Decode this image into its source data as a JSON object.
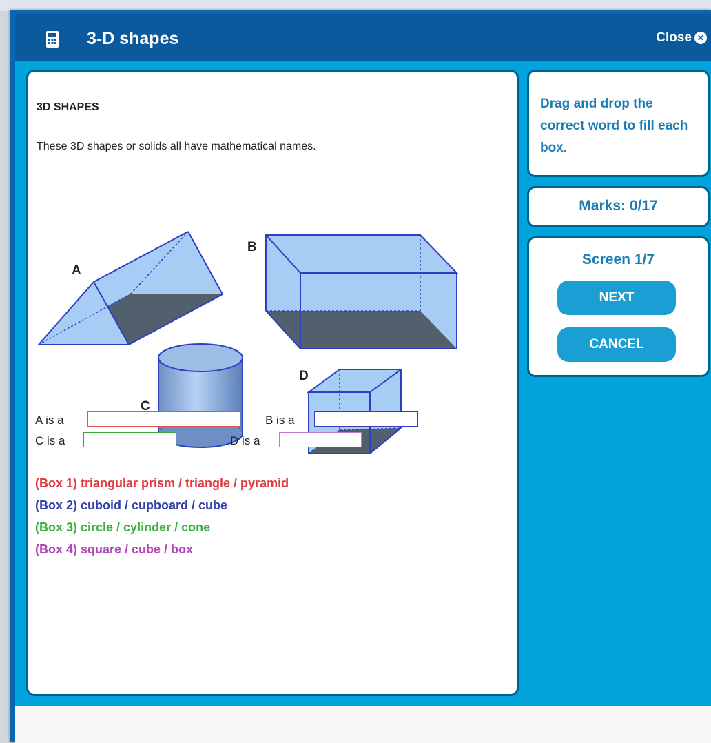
{
  "window": {
    "title": "3-D shapes",
    "close_label": "Close"
  },
  "content": {
    "heading": "3D SHAPES",
    "intro": "These 3D shapes or solids all have mathematical names.",
    "shape_labels": [
      "A",
      "B",
      "C",
      "D"
    ],
    "fill_ins": [
      {
        "label": "A is a",
        "value": "",
        "color": "#d9534f"
      },
      {
        "label": "B is a",
        "value": "",
        "color": "#3a3ab8"
      },
      {
        "label": "C is a",
        "value": "",
        "color": "#3aa43a"
      },
      {
        "label": "D is a",
        "value": "",
        "color": "#c27ad0"
      }
    ],
    "word_boxes": [
      {
        "text": "(Box 1) triangular prism / triangle / pyramid",
        "color": "#e0393e"
      },
      {
        "text": "(Box 2) cuboid / cupboard / cube",
        "color": "#343fa8"
      },
      {
        "text": "(Box 3) circle / cylinder / cone",
        "color": "#3cb043"
      },
      {
        "text": "(Box 4) square / cube / box",
        "color": "#b245b9"
      }
    ]
  },
  "sidebar": {
    "instruction": "Drag and drop the correct word to fill each box.",
    "marks": "Marks: 0/17",
    "screen": "Screen 1/7",
    "next_label": "NEXT",
    "cancel_label": "CANCEL"
  },
  "colors": {
    "titlebar": "#0b5a9e",
    "content_bg": "#00a3db",
    "accent_text": "#1a7eb4",
    "button": "#1a9fd4"
  }
}
